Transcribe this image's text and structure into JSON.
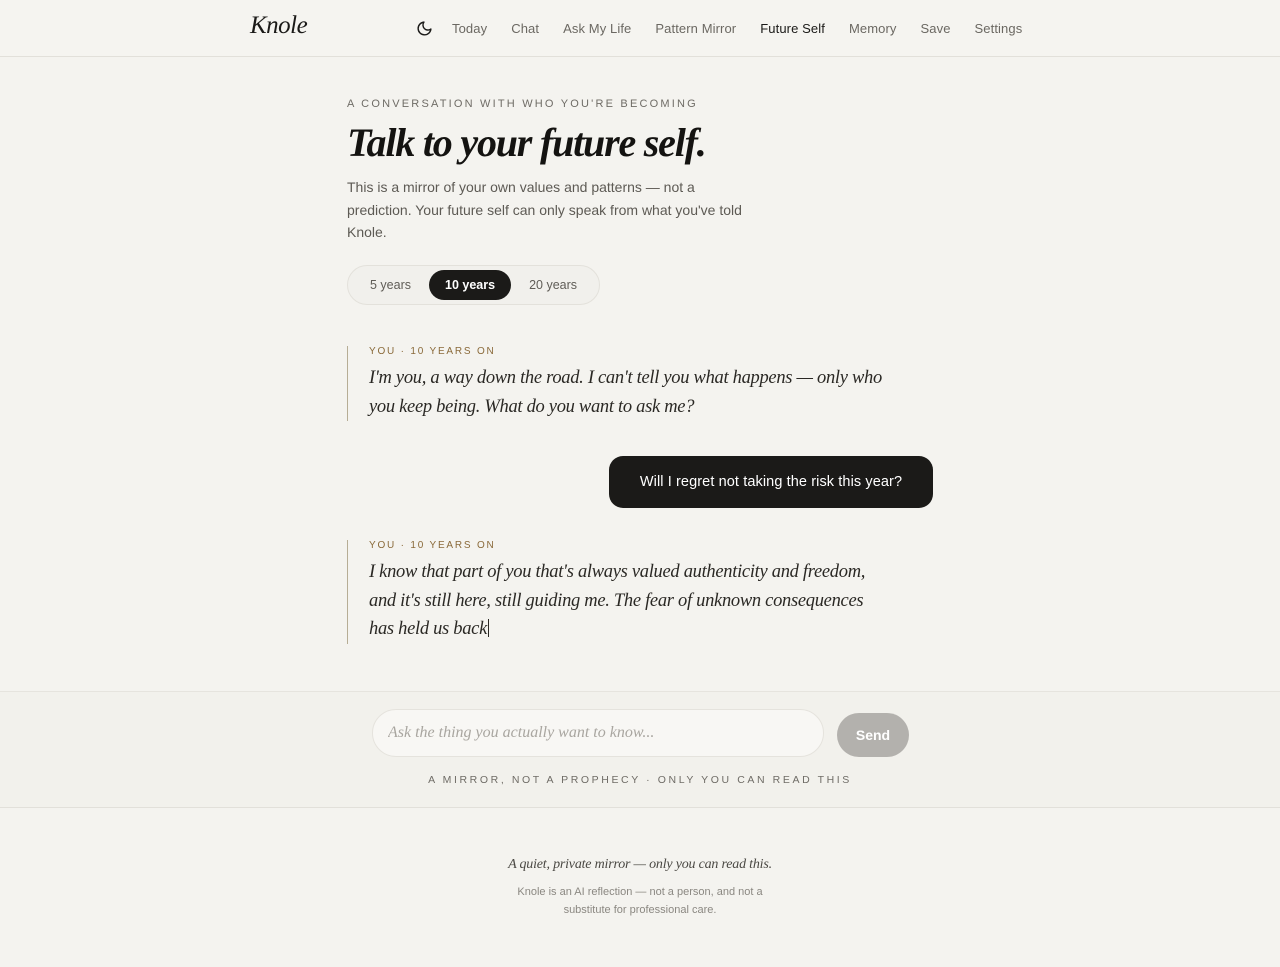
{
  "header": {
    "brand": "Knole",
    "theme_icon": "moon-icon",
    "nav": [
      {
        "label": "Today",
        "active": false
      },
      {
        "label": "Chat",
        "active": false
      },
      {
        "label": "Ask My Life",
        "active": false
      },
      {
        "label": "Pattern Mirror",
        "active": false
      },
      {
        "label": "Future Self",
        "active": true
      },
      {
        "label": "Memory",
        "active": false
      },
      {
        "label": "Save",
        "active": false
      },
      {
        "label": "Settings",
        "active": false
      }
    ]
  },
  "main": {
    "eyebrow": "A conversation with who you're becoming",
    "headline": "Talk to your future self.",
    "intro": "This is a mirror of your own values and patterns — not a prediction. Your future self can only speak from what you've told Knole.",
    "horizons": [
      {
        "label": "5 years",
        "selected": false
      },
      {
        "label": "10 years",
        "selected": true
      },
      {
        "label": "20 years",
        "selected": false
      }
    ]
  },
  "conversation": {
    "messages": [
      {
        "role": "future",
        "label": "You · 10 years on",
        "text": "I'm you, a way down the road. I can't tell you what happens — only who you keep being. What do you want to ask me?"
      },
      {
        "role": "user",
        "text": "Will I regret not taking the risk this year?"
      },
      {
        "role": "future",
        "label": "You · 10 years on",
        "text": "I know that part of you that's always valued authenticity and freedom, and it's still here, still guiding me. The fear of unknown consequences has held us back",
        "streaming": true
      }
    ]
  },
  "composer": {
    "placeholder": "Ask the thing you actually want to know...",
    "value": "",
    "send_label": "Send",
    "note": "A mirror, not a prophecy · Only you can read this"
  },
  "footer": {
    "tagline": "A quiet, private mirror — only you can read this.",
    "disclaimer": "Knole is an AI reflection — not a person, and not a substitute for professional care."
  }
}
